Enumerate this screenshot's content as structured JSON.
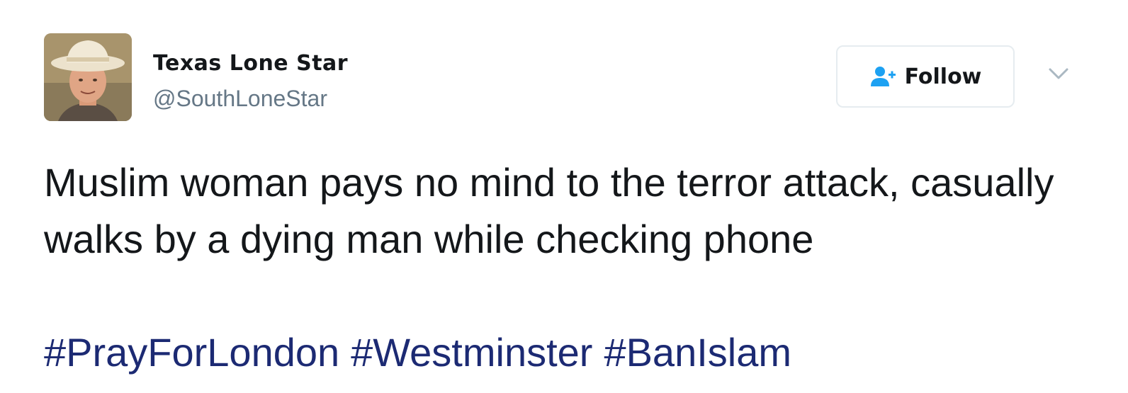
{
  "user": {
    "display_name": "Texas Lone Star",
    "handle": "@SouthLoneStar",
    "avatar_icon": "profile-photo"
  },
  "follow_button": {
    "label": "Follow",
    "icon": "add-user-icon"
  },
  "menu": {
    "icon": "chevron-down-icon"
  },
  "tweet": {
    "text": "Muslim woman pays no mind to the terror attack, casually walks by a dying man while checking phone",
    "hashtags": [
      "#PrayForLondon",
      "#Westminster",
      "#BanIslam"
    ]
  },
  "colors": {
    "text": "#14171a",
    "secondary": "#657786",
    "hashtag": "#1c2a73",
    "accent": "#1da1f2",
    "border": "#e6ecf0"
  }
}
